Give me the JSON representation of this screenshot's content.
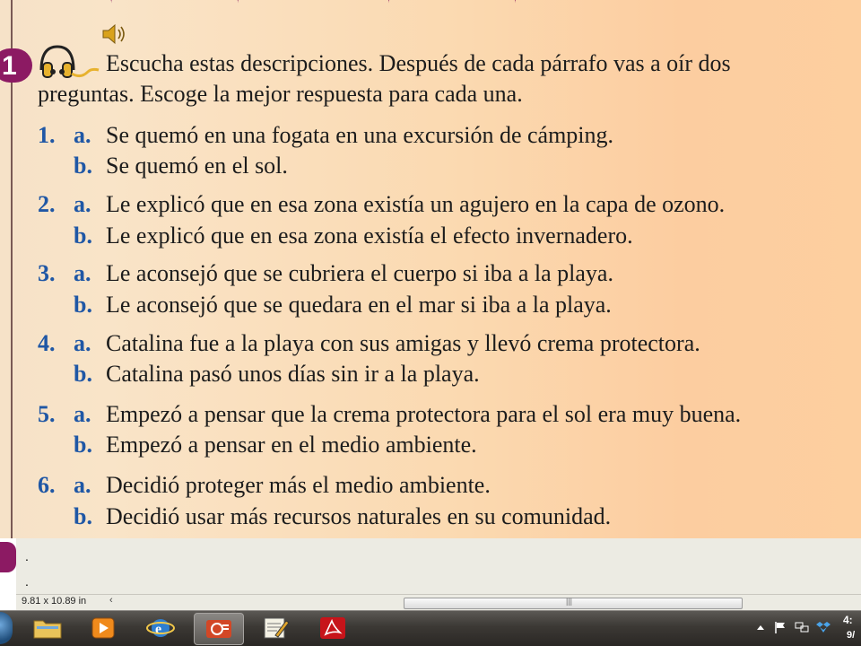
{
  "document": {
    "clipped_header": "— ✦ —  — ✦ ——— ✦ —  —  ✦ —",
    "exercise_number": "1",
    "instruction_line1": "Escucha estas descripciones. Después de cada párrafo vas a oír dos",
    "instruction_line2": "preguntas. Escoge la mejor respuesta para cada una.",
    "items": [
      {
        "num": "1.",
        "a": "Se quemó en una fogata en una excursión de cámping.",
        "b": "Se quemó en el sol."
      },
      {
        "num": "2.",
        "a": "Le explicó que en esa zona existía un agujero en la capa de ozono.",
        "b": "Le explicó que en esa zona existía el efecto invernadero."
      },
      {
        "num": "3.",
        "a": "Le aconsejó que se cubriera el cuerpo si iba a la playa.",
        "b": "Le aconsejó que se quedara en el mar si iba a la playa."
      },
      {
        "num": "4.",
        "a": "Catalina fue a la playa con sus amigas y llevó crema protectora.",
        "b": "Catalina pasó unos días sin ir a la playa."
      },
      {
        "num": "5.",
        "a": "Empezó a pensar que la crema protectora para el sol era muy buena.",
        "b": "Empezó a pensar en el medio ambiente."
      },
      {
        "num": "6.",
        "a": "Decidió proteger más el medio ambiente.",
        "b": "Decidió usar más recursos naturales en su comunidad."
      }
    ],
    "letter_a": "a.",
    "letter_b": "b."
  },
  "notes": {
    "line1": ".",
    "line2": "."
  },
  "status": {
    "page_size": "9.81 x 10.89 in",
    "scroll_left": "‹",
    "grip": "|||"
  },
  "taskbar": {
    "apps": [
      "file-explorer",
      "media-player",
      "internet-explorer",
      "powerpoint",
      "notes-app",
      "adobe-reader"
    ],
    "clock_time": "4:",
    "clock_date": "9/"
  },
  "colors": {
    "badge": "#8c1a63",
    "number_blue": "#1f57a5"
  }
}
